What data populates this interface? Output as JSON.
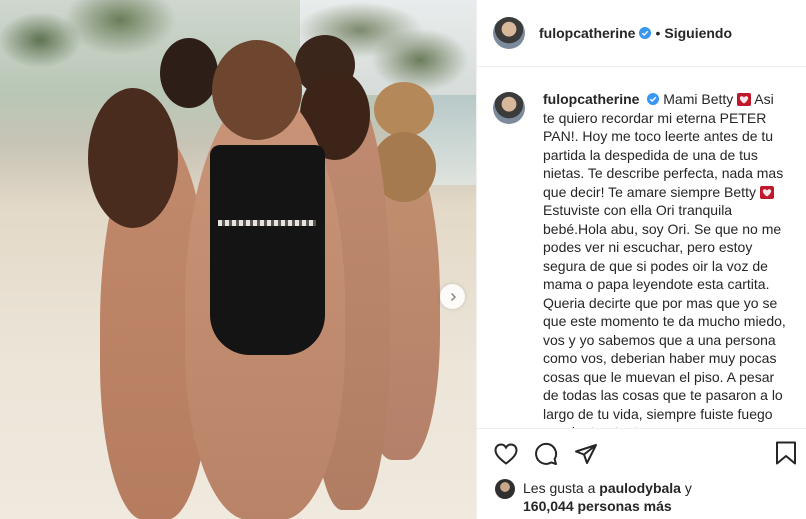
{
  "photo": {
    "alt_icon_next": "chevron-right-icon"
  },
  "header": {
    "username": "fulopcatherine",
    "dot": "•",
    "follow_status": "Siguiendo"
  },
  "caption": {
    "username": "fulopcatherine",
    "text_part1": "Mami Betty",
    "text_part2": "Asi te quiero recordar mi eterna PETER PAN!. Hoy me toco leerte antes de tu partida la despedida de una de tus nietas. Te describe perfecta, nada mas que decir! Te amare siempre Betty",
    "text_part3": "Estuviste con ella Ori tranquila bebé.Hola abu, soy Ori. Se que no me podes ver ni escuchar, pero estoy segura de que si podes oir la voz de mama o papa leyendote esta cartita. Queria decirte que por mas que yo se que este momento te da mucho miedo, vos y yo sabemos que a una persona como vos, deberian haber muy pocas cosas que le muevan el piso. A pesar de todas las cosas que te pasaron a lo largo de tu vida, siempre fuiste fuego por dentro, tanto que"
  },
  "likes": {
    "prefix": "Les gusta a",
    "user": "paulodybala",
    "mid": "y",
    "count": "160,044 personas más"
  },
  "icons": {
    "like": "heart-icon",
    "comment": "comment-icon",
    "share": "share-icon",
    "save": "bookmark-icon"
  },
  "colors": {
    "verified": "#3897f0",
    "emoji_heart": "#c0172b",
    "text": "#262626",
    "border": "#efefef"
  }
}
